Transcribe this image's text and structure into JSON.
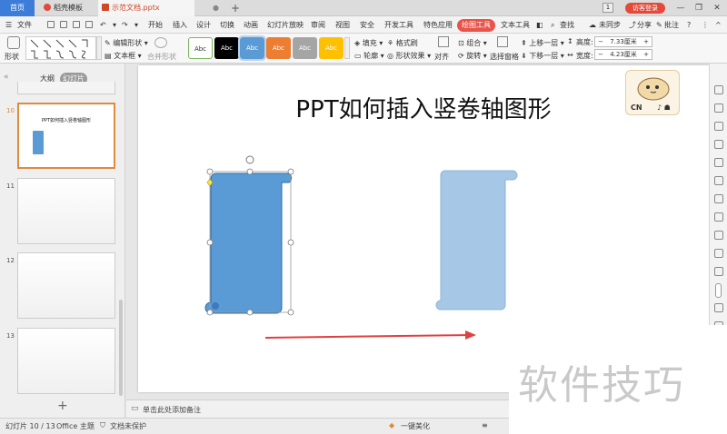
{
  "titlebar": {
    "home_tab": "首页",
    "template_tab": "稻壳模板",
    "doc_tab": "示范文档.pptx",
    "doc_dot": "●",
    "new_tab": "+",
    "badge": "1",
    "login": "访客登录",
    "minimize": "—",
    "maximize": "❐",
    "close": "✕"
  },
  "menubar": {
    "file": "文件",
    "items": [
      "开始",
      "插入",
      "设计",
      "切换",
      "动画",
      "幻灯片放映",
      "审阅",
      "视图",
      "安全",
      "开发工具",
      "特色应用",
      "绘图工具",
      "文本工具"
    ],
    "active": "绘图工具",
    "search": "查找",
    "sync": "未同步",
    "share": "分享",
    "comment": "批注",
    "help": "?",
    "more": "⋮",
    "collapse": "^"
  },
  "ribbon": {
    "shape": "形状",
    "edit_shape": "编辑形状",
    "textbox": "文本框",
    "merge_shape": "合并形状",
    "style_samples": [
      "Abc",
      "Abc",
      "Abc",
      "Abc",
      "Abc",
      "Abc"
    ],
    "fill": "填充",
    "format_brush": "格式刷",
    "outline": "轮廓",
    "shape_effect": "形状效果",
    "align": "对齐",
    "group": "组合",
    "rotate": "旋转",
    "selection_pane": "选择窗格",
    "bring_forward": "上移一层",
    "send_backward": "下移一层",
    "height_label": "高度:",
    "height_value": "7.33厘米",
    "width_label": "宽度:",
    "width_value": "4.23厘米",
    "minus": "−",
    "plus": "+"
  },
  "left_panel": {
    "outline_tab": "大纲",
    "slides_tab": "幻灯片",
    "thumbs": [
      {
        "num": "10",
        "title": "PPT如何插入竖卷轴图形"
      },
      {
        "num": "11",
        "title": ""
      },
      {
        "num": "12",
        "title": ""
      },
      {
        "num": "13",
        "title": ""
      }
    ],
    "add": "+",
    "collapse": "«"
  },
  "slide": {
    "title": "PPT如何插入竖卷轴图形",
    "logo_text": "CN",
    "logo_extra": "♪ ☗"
  },
  "notes": {
    "placeholder": "单击此处添加备注"
  },
  "statusbar": {
    "slide_info": "幻灯片 10 / 13",
    "theme": "Office 主题",
    "protect": "文档未保护",
    "beautify": "一键美化",
    "view_icon": "≡"
  },
  "watermark": {
    "text": "软件技巧"
  },
  "colors": {
    "accent": "#e8534a",
    "scroll_selected": "#5b9bd5",
    "scroll_faded": "#a6c8e6",
    "arrow": "#e04040",
    "style_colors": [
      "#ffffff",
      "#000000",
      "#5b9bd5",
      "#ed7d31",
      "#a5a5a5",
      "#ffc000"
    ]
  }
}
